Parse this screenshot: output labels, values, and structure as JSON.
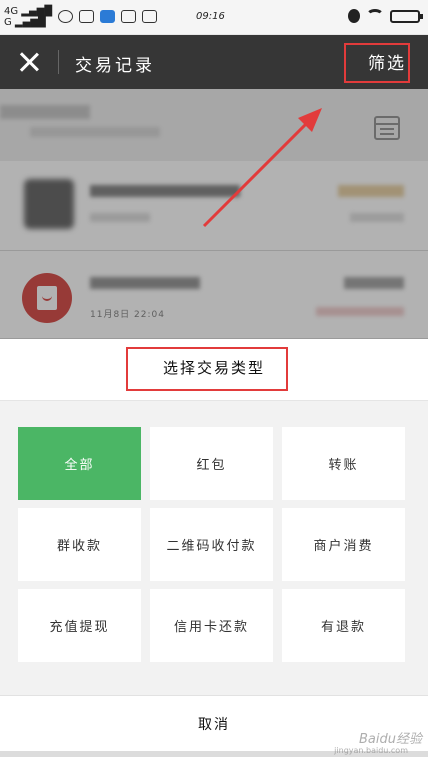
{
  "status_bar": {
    "network_label": "4G",
    "time": "09:16"
  },
  "header": {
    "title": "交易记录",
    "filter_label": "筛选"
  },
  "transactions": {
    "row2_date": "11月8日 22:04"
  },
  "sheet": {
    "title": "选择交易类型",
    "options": [
      {
        "label": "全部",
        "selected": true
      },
      {
        "label": "红包",
        "selected": false
      },
      {
        "label": "转账",
        "selected": false
      },
      {
        "label": "群收款",
        "selected": false
      },
      {
        "label": "二维码收付款",
        "selected": false
      },
      {
        "label": "商户消费",
        "selected": false
      },
      {
        "label": "充值提现",
        "selected": false
      },
      {
        "label": "信用卡还款",
        "selected": false
      },
      {
        "label": "有退款",
        "selected": false
      }
    ],
    "cancel_label": "取消"
  },
  "colors": {
    "header_bg": "#363636",
    "selected_option": "#4bb665",
    "annotation_red": "#e23b3b",
    "red_packet": "#d9534f"
  },
  "watermark": {
    "text": "Baidu经验",
    "sub": "jingyan.baidu.com"
  }
}
